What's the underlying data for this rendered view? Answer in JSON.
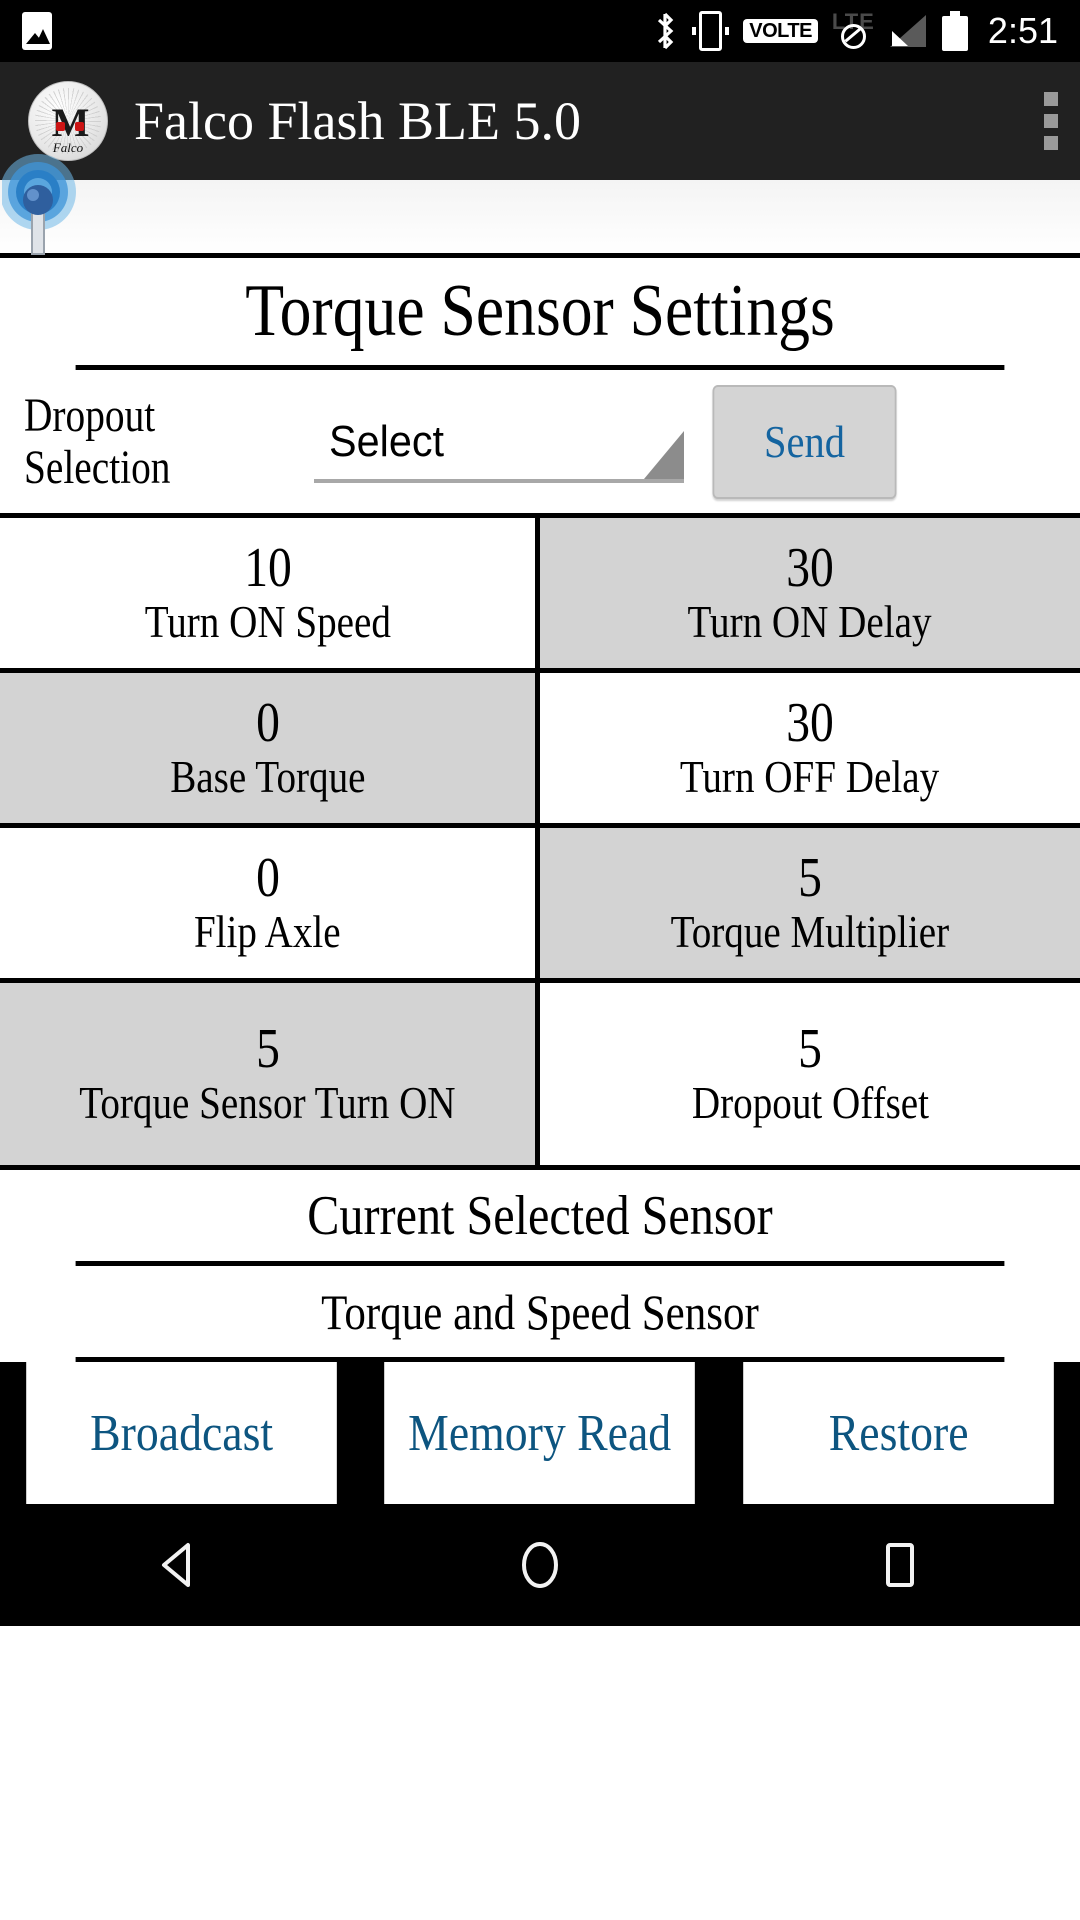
{
  "status_bar": {
    "time": "2:51",
    "volte_label": "VOLTE",
    "lte_label": "LTE",
    "icons": [
      "photo-icon",
      "bluetooth-icon",
      "vibrate-icon",
      "volte-icon",
      "lte-no-data-icon",
      "signal-icon",
      "battery-icon"
    ]
  },
  "app_bar": {
    "title": "Falco Flash BLE 5.0",
    "logo_wordmark": "Falco",
    "logo_emblem": "M",
    "overflow_label": "overflow-menu"
  },
  "page": {
    "title": "Torque Sensor Settings"
  },
  "dropout": {
    "label": "Dropout Selection",
    "spinner_value": "Select",
    "send_label": "Send"
  },
  "settings_grid": [
    [
      {
        "value": "10",
        "caption": "Turn ON Speed",
        "shaded": false
      },
      {
        "value": "30",
        "caption": "Turn ON Delay",
        "shaded": true
      }
    ],
    [
      {
        "value": "0",
        "caption": "Base Torque",
        "shaded": true
      },
      {
        "value": "30",
        "caption": "Turn OFF Delay",
        "shaded": false
      }
    ],
    [
      {
        "value": "0",
        "caption": "Flip Axle",
        "shaded": false
      },
      {
        "value": "5",
        "caption": "Torque Multiplier",
        "shaded": true
      }
    ],
    [
      {
        "value": "5",
        "caption": "Torque Sensor Turn ON",
        "shaded": true
      },
      {
        "value": "5",
        "caption": "Dropout Offset",
        "shaded": false
      }
    ]
  ],
  "current_sensor": {
    "heading": "Current Selected Sensor",
    "value": "Torque and Speed Sensor"
  },
  "actions": [
    {
      "label": "Broadcast"
    },
    {
      "label": "Memory Read"
    },
    {
      "label": "Restore"
    }
  ],
  "nav_bar": {
    "back": "back-icon",
    "home": "home-icon",
    "recents": "recents-icon"
  },
  "colors": {
    "appbar_bg": "#212121",
    "status_bg": "#000000",
    "shade_cell": "#d3d3d3",
    "send_text": "#1464a0",
    "action_text": "#0d5580",
    "logo_accent": "#cc1414"
  }
}
